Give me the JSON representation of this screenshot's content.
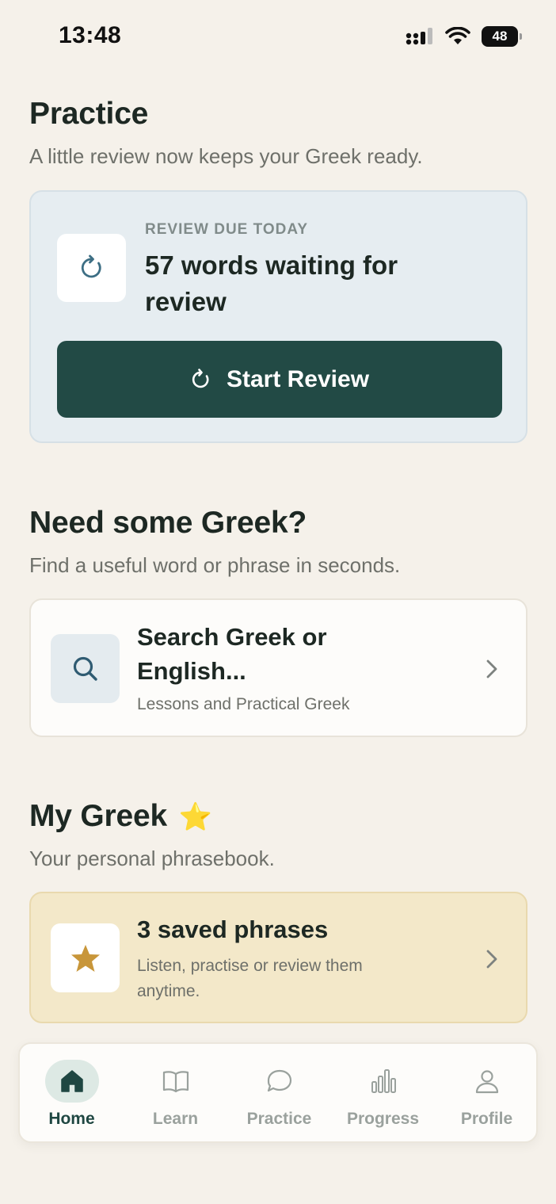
{
  "status_bar": {
    "time": "13:48",
    "battery": "48"
  },
  "practice": {
    "title": "Practice",
    "subtitle": "A little review now keeps your Greek ready.",
    "review_card": {
      "eyebrow": "REVIEW DUE TODAY",
      "title": "57 words waiting for review",
      "button_label": "Start Review"
    }
  },
  "need_greek": {
    "title": "Need some Greek?",
    "subtitle": "Find a useful word or phrase in seconds.",
    "search_card": {
      "title": "Search Greek or English...",
      "subtitle": "Lessons and Practical Greek"
    }
  },
  "my_greek": {
    "title": "My Greek",
    "emoji": "⭐",
    "subtitle": "Your personal phrasebook.",
    "saved_card": {
      "title": "3 saved phrases",
      "subtitle": "Listen, practise or review them anytime."
    }
  },
  "tabs": [
    {
      "label": "Home",
      "icon": "home-icon",
      "active": true
    },
    {
      "label": "Learn",
      "icon": "book-icon",
      "active": false
    },
    {
      "label": "Practice",
      "icon": "chat-bubble-icon",
      "active": false
    },
    {
      "label": "Progress",
      "icon": "bar-chart-icon",
      "active": false
    },
    {
      "label": "Profile",
      "icon": "person-icon",
      "active": false
    }
  ],
  "colors": {
    "background": "#f5f1ea",
    "primary": "#224a45",
    "review_card_bg": "#e6edf1",
    "saved_card_bg": "#f3e8c9",
    "star": "#c8963a"
  }
}
